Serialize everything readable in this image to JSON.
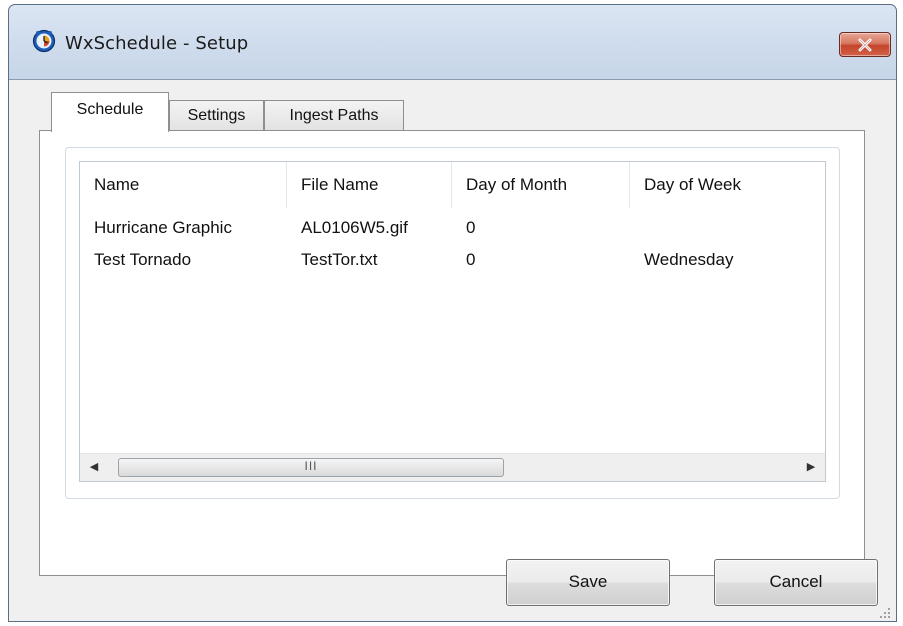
{
  "window": {
    "title": "WxSchedule - Setup",
    "app_icon": "clock-icon",
    "close_icon": "close-icon"
  },
  "tabs": [
    {
      "label": "Schedule",
      "active": true
    },
    {
      "label": "Settings",
      "active": false
    },
    {
      "label": "Ingest Paths",
      "active": false
    }
  ],
  "schedule_list": {
    "columns": [
      "Name",
      "File Name",
      "Day of Month",
      "Day of Week"
    ],
    "rows": [
      [
        "Hurricane Graphic",
        "AL0106W5.gif",
        "0",
        ""
      ],
      [
        "Test Tornado",
        "TestTor.txt",
        "0",
        "Wednesday"
      ]
    ],
    "scrollbar": {
      "left_arrow": "◀",
      "right_arrow": "▶",
      "thumb_grip": "III"
    }
  },
  "buttons": {
    "save": "Save",
    "cancel": "Cancel"
  },
  "colors": {
    "title_bar": "#cfdced",
    "close_button": "#c4452a",
    "client": "#f0f0f0"
  }
}
